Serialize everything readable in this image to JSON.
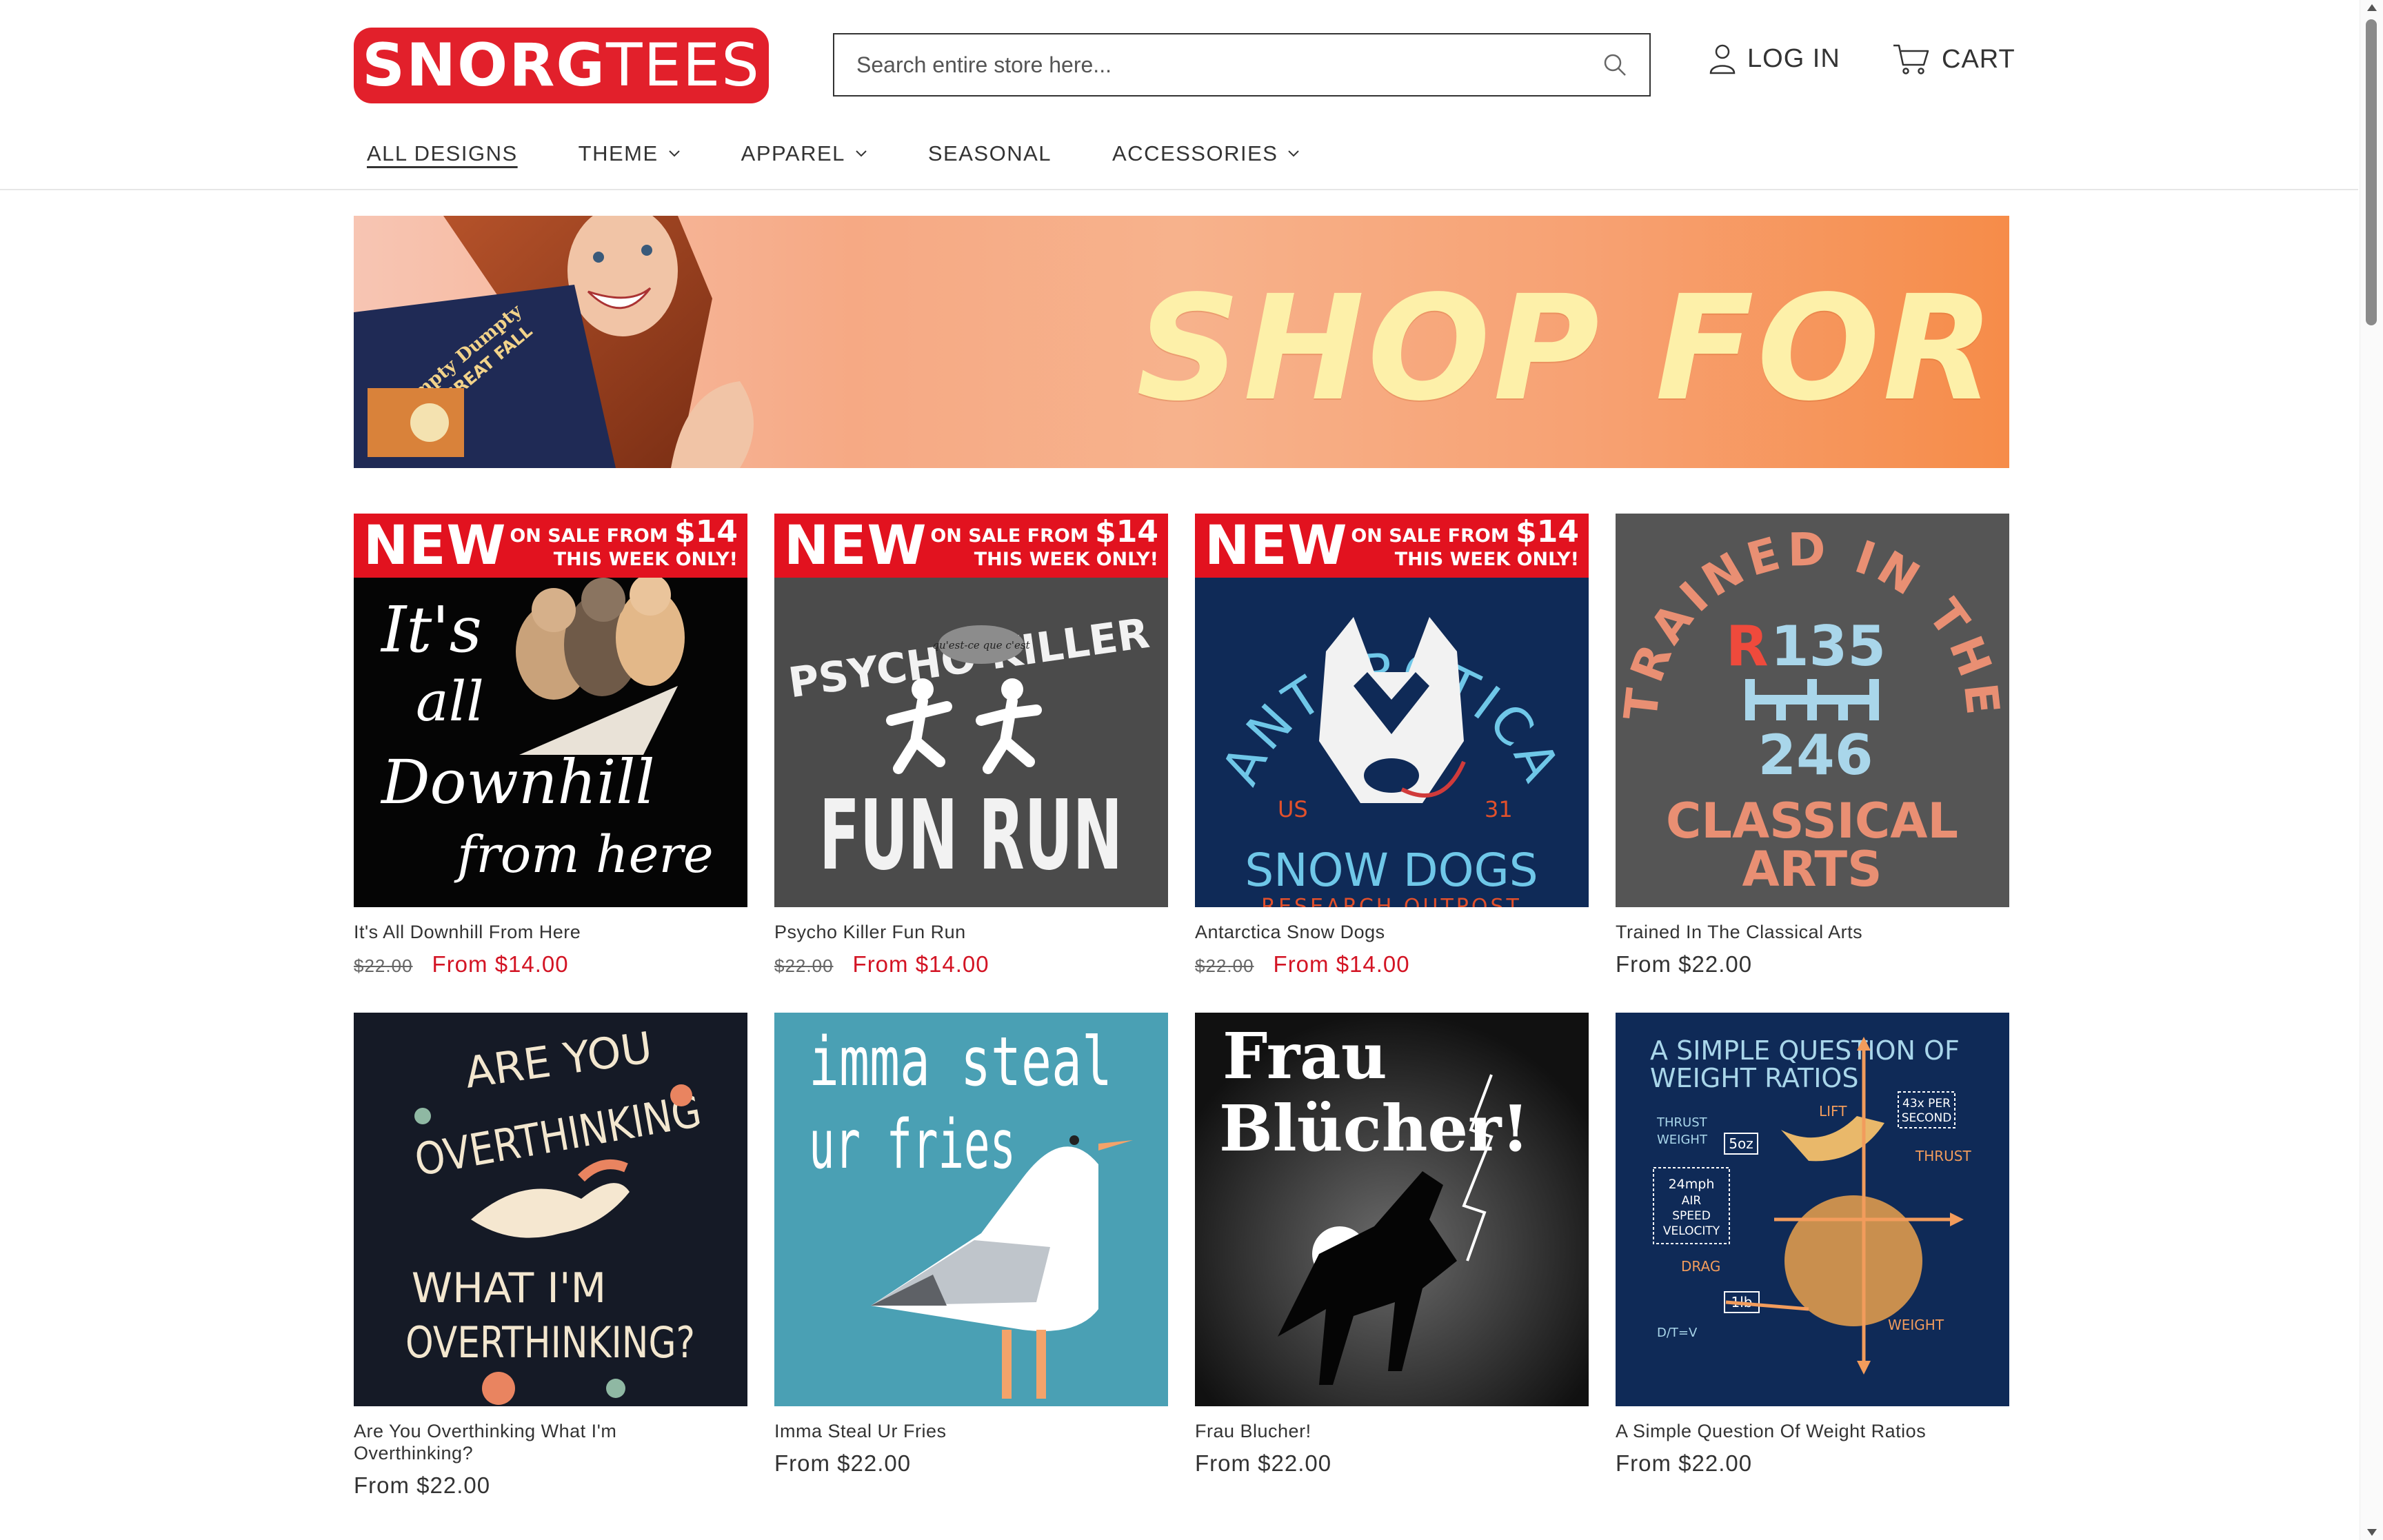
{
  "header": {
    "logo_bold": "SNORG",
    "logo_light": "TEES",
    "search_placeholder": "Search entire store here...",
    "login_label": "LOG IN",
    "cart_label": "CART"
  },
  "nav": {
    "items": [
      {
        "label": "ALL DESIGNS",
        "dropdown": false,
        "active": true
      },
      {
        "label": "THEME",
        "dropdown": true
      },
      {
        "label": "APPAREL",
        "dropdown": true
      },
      {
        "label": "SEASONAL",
        "dropdown": false
      },
      {
        "label": "ACCESSORIES",
        "dropdown": true
      }
    ]
  },
  "banner": {
    "title": "SHOP FOR FALL",
    "shirt_text_1": "Humpty Dumpty",
    "shirt_text_2": "HAD A GREAT FALL"
  },
  "badge": {
    "new": "NEW",
    "sale_line_1": "ON SALE FROM",
    "sale_price": "$14",
    "sale_line_2": "THIS WEEK ONLY!"
  },
  "products": [
    {
      "name": "It's All Downhill From Here",
      "old_price": "$22.00",
      "price": "From $14.00",
      "on_sale": true,
      "art": {
        "line1": "It's",
        "line2": "all",
        "line3": "Downhill",
        "line4": "from here"
      }
    },
    {
      "name": "Psycho Killer Fun Run",
      "old_price": "$22.00",
      "price": "From $14.00",
      "on_sale": true,
      "art": {
        "top": "PSYCHO KILLER",
        "speech": "qu'est-ce que c'est",
        "bottom": "FUN RUN"
      }
    },
    {
      "name": "Antarctica Snow Dogs",
      "old_price": "$22.00",
      "price": "From $14.00",
      "on_sale": true,
      "art": {
        "arc": "ANTARCTICA",
        "left": "US",
        "right": "31",
        "bottom": "SNOW DOGS",
        "sub": "RESEARCH OUTPOST"
      }
    },
    {
      "name": "Trained In The Classical Arts",
      "price": "From $22.00",
      "on_sale": false,
      "art": {
        "arc": "TRAINED IN THE",
        "r": "R",
        "top_nums": "135",
        "bottom_nums": "246",
        "line1": "CLASSICAL",
        "line2": "ARTS"
      }
    },
    {
      "name": "Are You Overthinking What I'm Overthinking?",
      "price": "From $22.00",
      "on_sale": false,
      "art": {
        "line1": "ARE YOU",
        "line2": "OVERTHINKING",
        "line3": "WHAT I'M",
        "line4": "OVERTHINKING?"
      }
    },
    {
      "name": "Imma Steal Ur Fries",
      "price": "From $22.00",
      "on_sale": false,
      "art": {
        "line1": "imma steal",
        "line2": "ur fries"
      }
    },
    {
      "name": "Frau Blucher!",
      "price": "From $22.00",
      "on_sale": false,
      "art": {
        "line1": "Frau",
        "line2": "Blücher!"
      }
    },
    {
      "name": "A Simple Question Of Weight Ratios",
      "price": "From $22.00",
      "on_sale": false,
      "art": {
        "title1": "A SIMPLE QUESTION OF",
        "title2": "WEIGHT RATIOS",
        "thrust_weight_1": "THRUST",
        "thrust_weight_2": "WEIGHT",
        "oz": "5oz",
        "lift": "LIFT",
        "per_sec_1": "43x PER",
        "per_sec_2": "SECOND",
        "thrust": "THRUST",
        "speed_1": "24mph",
        "speed_2": "AIR",
        "speed_3": "SPEED",
        "speed_4": "VELOCITY",
        "drag": "DRAG",
        "lb": "1lb",
        "weight": "WEIGHT",
        "formula": "D/T=V"
      }
    }
  ],
  "colors": {
    "brand_red": "#e2202b",
    "sale_red": "#d31424"
  }
}
